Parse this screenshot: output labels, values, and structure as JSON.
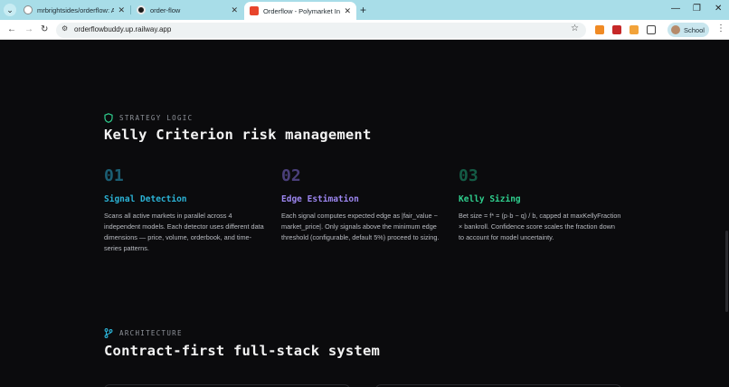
{
  "browser": {
    "tabs": [
      {
        "title": "mrbrightsides/orderflow: A live",
        "active": false
      },
      {
        "title": "order-flow",
        "active": false
      },
      {
        "title": "Orderflow - Polymarket Intellig",
        "active": true
      }
    ],
    "url": "orderflowbuddy.up.railway.app",
    "profile_label": "School"
  },
  "strategy": {
    "eyebrow": "STRATEGY LOGIC",
    "heading": "Kelly Criterion risk management",
    "steps": [
      {
        "num": "01",
        "title": "Signal Detection",
        "desc": "Scans all active markets in parallel across 4 independent models. Each detector uses different data dimensions — price, volume, orderbook, and time-series patterns.",
        "num_color": "#1b5e73",
        "title_color": "#2bb3d6"
      },
      {
        "num": "02",
        "title": "Edge Estimation",
        "desc": "Each signal computes expected edge as |fair_value − market_price|. Only signals above the minimum edge threshold (configurable, default 5%) proceed to sizing.",
        "num_color": "#4a3f7a",
        "title_color": "#9c86f0"
      },
      {
        "num": "03",
        "title": "Kelly Sizing",
        "desc": "Bet size = f* = (p·b − q) / b, capped at maxKellyFraction × bankroll. Confidence score scales the fraction down to account for model uncertainty.",
        "num_color": "#145b45",
        "title_color": "#2fcf8e"
      }
    ]
  },
  "architecture": {
    "eyebrow": "ARCHITECTURE",
    "heading": "Contract-first full-stack system"
  },
  "colors": {
    "page_bg": "#0b0b0d",
    "tabstrip_bg": "#a8dde8",
    "accent_teal": "#2bb3d6"
  }
}
